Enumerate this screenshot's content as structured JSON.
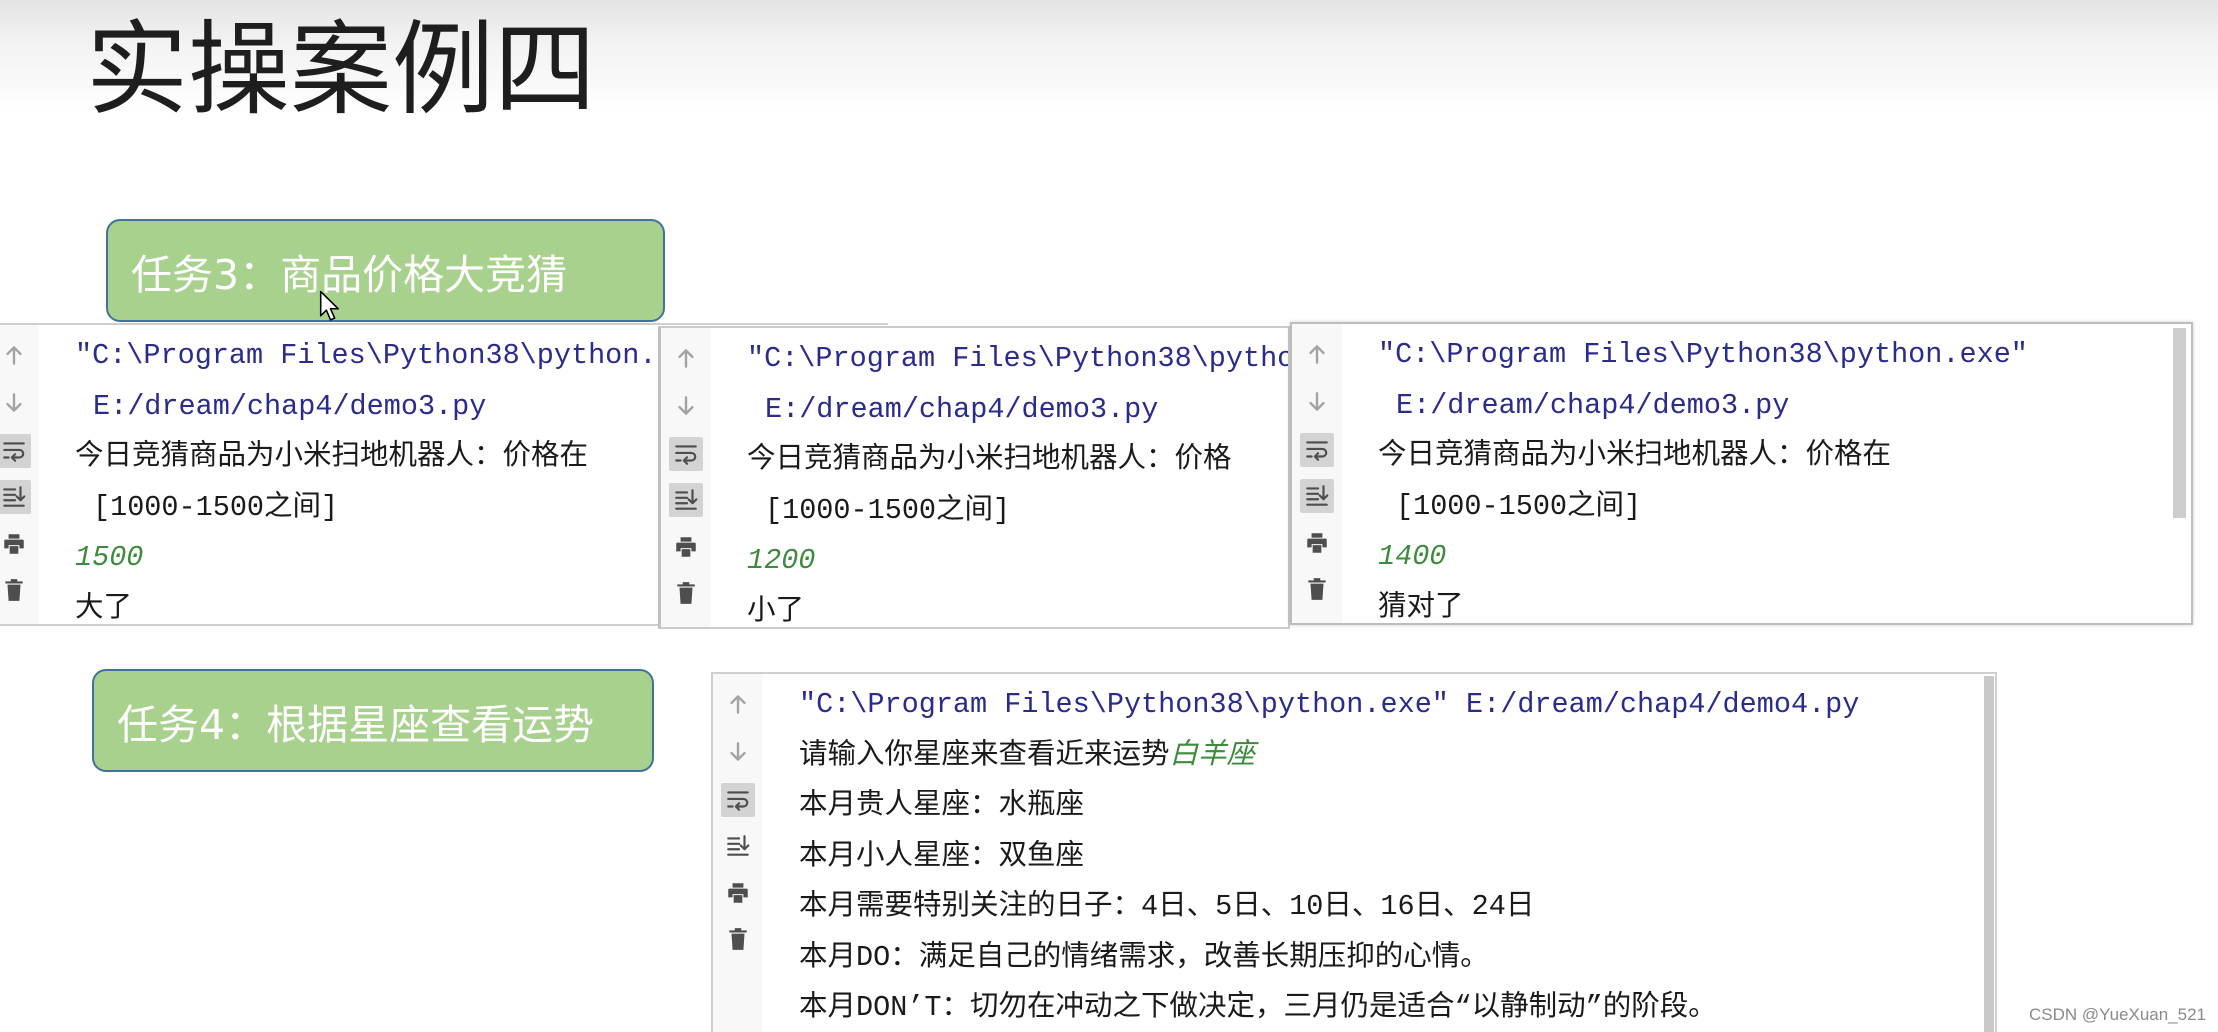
{
  "slide": {
    "title": "实操案例四",
    "watermark": "CSDN @YueXuan_521"
  },
  "tasks": {
    "task3": "任务3：商品价格大竞猜",
    "task4": "任务4：根据星座查看运势"
  },
  "colors": {
    "task_fill": "#a9d18e",
    "task_border": "#41719c",
    "command_text": "#2b2b8c",
    "output_text": "#1a1a1a",
    "user_input_text": "#3d8b3d",
    "toggle_active": "#d3d3d3"
  },
  "toolbar_icons": [
    "up-arrow-icon",
    "down-arrow-icon",
    "soft-wrap-icon",
    "scroll-to-end-icon",
    "print-icon",
    "trash-icon"
  ],
  "consoles": [
    {
      "soft_wrap_active": true,
      "scroll_to_end_active": true,
      "lines": [
        {
          "text": "\"C:\\Program Files\\Python38\\python."
        },
        {
          "text": "E:/dream/chap4/demo3.py"
        },
        {
          "text": "今日竞猜商品为小米扫地机器人：价格在"
        },
        {
          "text": "[1000-1500之间]"
        },
        {
          "text": "1500"
        },
        {
          "text": "大了"
        }
      ]
    },
    {
      "soft_wrap_active": true,
      "scroll_to_end_active": true,
      "lines": [
        {
          "text": "\"C:\\Program Files\\Python38\\pytho"
        },
        {
          "text": "E:/dream/chap4/demo3.py"
        },
        {
          "text": "今日竞猜商品为小米扫地机器人：价格"
        },
        {
          "text": "[1000-1500之间]"
        },
        {
          "text": "1200"
        },
        {
          "text": "小了"
        }
      ]
    },
    {
      "soft_wrap_active": true,
      "scroll_to_end_active": true,
      "lines": [
        {
          "text": "\"C:\\Program Files\\Python38\\python.exe\""
        },
        {
          "text": "E:/dream/chap4/demo3.py"
        },
        {
          "text": "今日竞猜商品为小米扫地机器人：价格在"
        },
        {
          "text": "[1000-1500之间]"
        },
        {
          "text": "1400"
        },
        {
          "text": "猜对了"
        }
      ]
    },
    {
      "soft_wrap_active": true,
      "scroll_to_end_active": false,
      "lines": [
        {
          "text": "\"C:\\Program Files\\Python38\\python.exe\" E:/dream/chap4/demo4.py"
        },
        {
          "prompt": "请输入你星座来查看近来运势",
          "input": "白羊座"
        },
        {
          "text": "本月贵人星座：水瓶座"
        },
        {
          "text": "本月小人星座：双鱼座"
        },
        {
          "text": "本月需要特别关注的日子：4日、5日、10日、16日、24日"
        },
        {
          "text": "本月DO：满足自己的情绪需求，改善长期压抑的心情。"
        },
        {
          "text": "本月DON’T：切勿在冲动之下做决定，三月仍是适合“以静制动”的阶段。"
        }
      ]
    }
  ]
}
